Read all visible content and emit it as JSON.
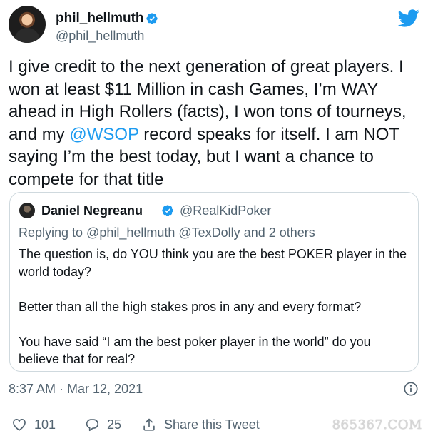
{
  "author": {
    "display_name": "phil_hellmuth",
    "handle": "@phil_hellmuth",
    "avatar": "avatar",
    "verified_icon": "verified-badge-icon"
  },
  "brand": {
    "logo_icon": "twitter-bird-icon",
    "accent_color": "#1d9bf0"
  },
  "tweet": {
    "text_before": "I give credit to the next generation of great players. I won at least $11 Million in cash Games, I’m WAY ahead in High Rollers (facts), I won tons of tourneys, and my ",
    "mention": "@WSOP",
    "text_after": " record speaks for itself. I am NOT saying I’m the best today, but I want a chance to compete for that title"
  },
  "quoted_tweet": {
    "display_name": "Daniel Negreanu",
    "handle": "@RealKidPoker",
    "replying_to": "Replying to @phil_hellmuth @TexDolly and 2 others",
    "paragraphs": [
      "The question is, do YOU think you are the best POKER player in the world today?",
      "Better than all the high stakes pros in any and every format?",
      "You have said “I am the best poker player in the world” do you believe that for real?"
    ]
  },
  "meta": {
    "timestamp": "8:37 AM · Mar 12, 2021",
    "info_icon": "info-icon"
  },
  "actions": {
    "like_count": "101",
    "reply_count": "25",
    "share_label": "Share this Tweet",
    "like_icon": "heart-icon",
    "reply_icon": "reply-bubble-icon",
    "share_icon": "share-icon"
  },
  "watermark": {
    "text": "865367.COM"
  }
}
